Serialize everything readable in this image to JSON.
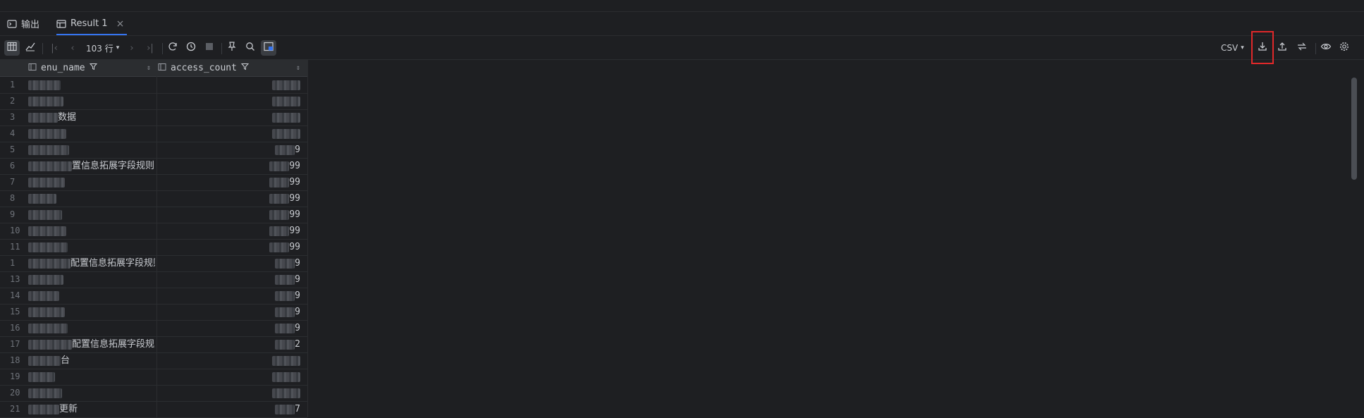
{
  "tabs": [
    {
      "label": "输出",
      "icon": "terminal-icon"
    },
    {
      "label": "Result 1",
      "icon": "table-icon"
    }
  ],
  "toolbar": {
    "rows_count": "103 行",
    "export_format": "CSV"
  },
  "columns": [
    {
      "label": "menu_name",
      "visible_label": "enu_name"
    },
    {
      "label": "access_count"
    }
  ],
  "rows": [
    {
      "n": "1",
      "name": "",
      "count": ""
    },
    {
      "n": "2",
      "name": "",
      "count": ""
    },
    {
      "n": "3",
      "name": "数据",
      "count": ""
    },
    {
      "n": "4",
      "name": "",
      "count": ""
    },
    {
      "n": "5",
      "name": "",
      "count": "9"
    },
    {
      "n": "6",
      "name": "置信息拓展字段规则",
      "count": "99"
    },
    {
      "n": "7",
      "name": "",
      "count": "99"
    },
    {
      "n": "8",
      "name": "",
      "count": "99"
    },
    {
      "n": "9",
      "name": "",
      "count": "99"
    },
    {
      "n": "10",
      "name": "",
      "count": "99"
    },
    {
      "n": "11",
      "name": "",
      "count": "99"
    },
    {
      "n": "1",
      "name": "配置信息拓展字段规则",
      "count": "9"
    },
    {
      "n": "13",
      "name": "",
      "count": "9"
    },
    {
      "n": "14",
      "name": "",
      "count": "9"
    },
    {
      "n": "15",
      "name": "",
      "count": "9"
    },
    {
      "n": "16",
      "name": "",
      "count": "9"
    },
    {
      "n": "17",
      "name": "配置信息拓展字段规则",
      "count": "2"
    },
    {
      "n": "18",
      "name": "台",
      "count": ""
    },
    {
      "n": "19",
      "name": "",
      "count": ""
    },
    {
      "n": "20",
      "name": "",
      "count": ""
    },
    {
      "n": "21",
      "name": "更新",
      "count": "7"
    }
  ]
}
